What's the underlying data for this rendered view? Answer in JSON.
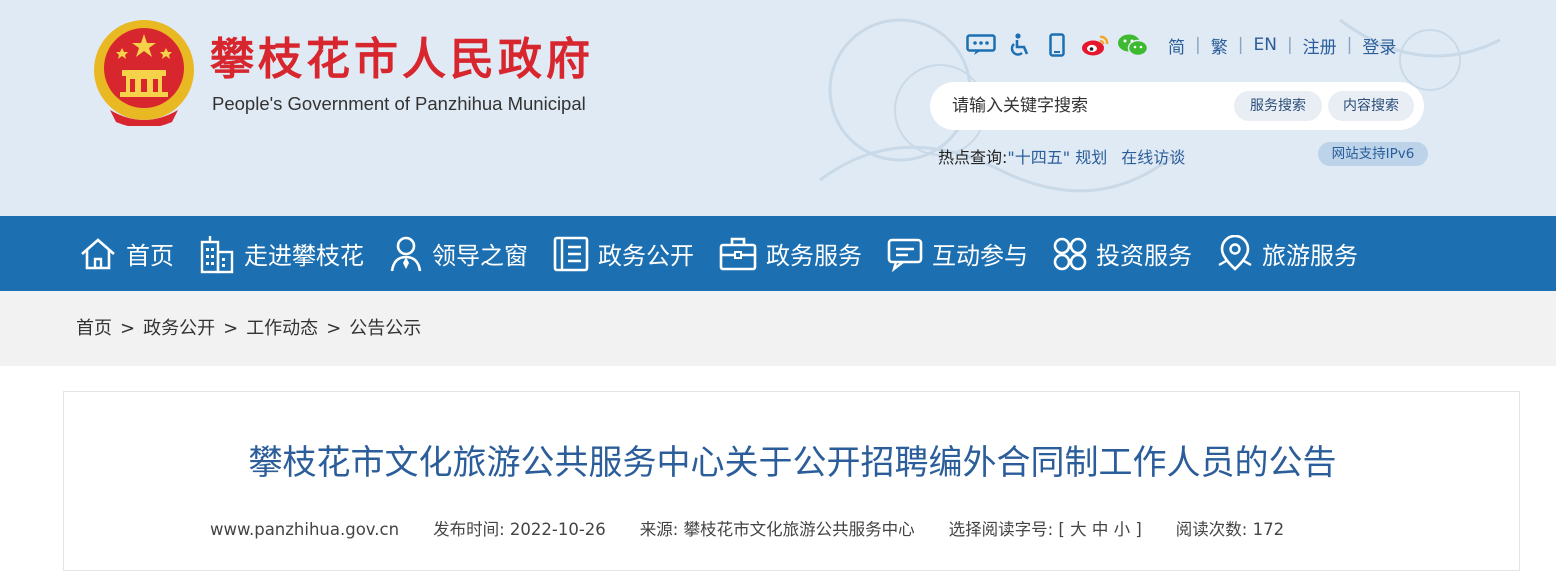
{
  "header": {
    "title": "攀枝花市人民政府",
    "subtitle": "People's Government of Panzhihua Municipal",
    "icons": [
      "message-icon",
      "accessibility-icon",
      "mobile-icon",
      "weibo-icon",
      "wechat-icon"
    ],
    "lang_links": [
      "简",
      "繁",
      "EN",
      "注册",
      "登录"
    ],
    "search_placeholder": "请输入关键字搜索",
    "search_service_label": "服务搜索",
    "search_content_label": "内容搜索",
    "hot_label": "热点查询:",
    "hot_links": [
      "\"十四五\" 规划",
      "在线访谈"
    ],
    "ipv6_badge": "网站支持IPv6"
  },
  "nav": {
    "items": [
      {
        "label": "首页",
        "icon": "home-icon"
      },
      {
        "label": "走进攀枝花",
        "icon": "building-icon"
      },
      {
        "label": "领导之窗",
        "icon": "person-icon"
      },
      {
        "label": "政务公开",
        "icon": "document-icon"
      },
      {
        "label": "政务服务",
        "icon": "briefcase-icon"
      },
      {
        "label": "互动参与",
        "icon": "chat-icon"
      },
      {
        "label": "投资服务",
        "icon": "grid-icon"
      },
      {
        "label": "旅游服务",
        "icon": "location-icon"
      }
    ]
  },
  "breadcrumb": {
    "items": [
      "首页",
      "政务公开",
      "工作动态",
      "公告公示"
    ],
    "separator": ">"
  },
  "article": {
    "title": "攀枝花市文化旅游公共服务中心关于公开招聘编外合同制工作人员的公告",
    "site": "www.panzhihua.gov.cn",
    "date_label": "发布时间:",
    "date": "2022-10-26",
    "source_label": "来源:",
    "source": "攀枝花市文化旅游公共服务中心",
    "font_label": "选择阅读字号:",
    "font_open": "[",
    "font_large": "大",
    "font_medium": "中",
    "font_small": "小",
    "font_close": "]",
    "views_label": "阅读次数:",
    "views": "172"
  },
  "colors": {
    "brand_red": "#d8262e",
    "nav_blue": "#1c6fb1",
    "link_blue": "#2b5d9a",
    "header_bg": "#dfeaf4"
  }
}
